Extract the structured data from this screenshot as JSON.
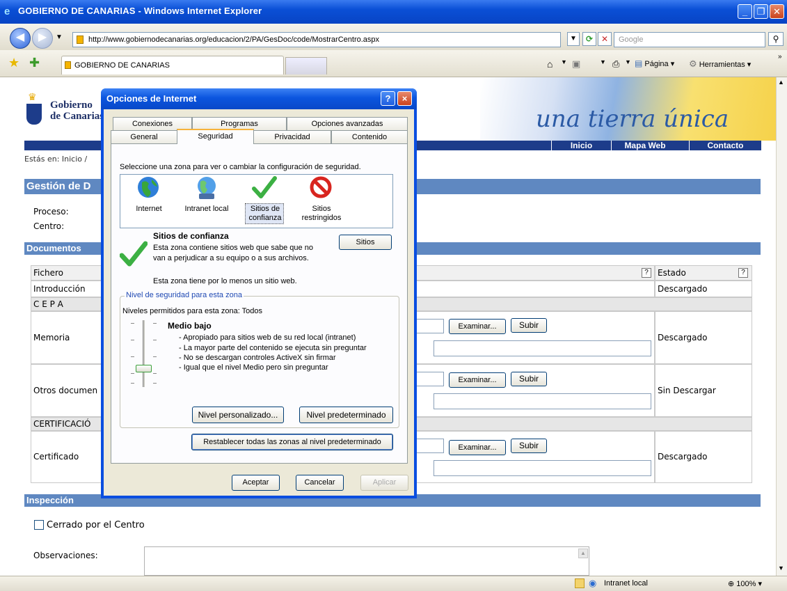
{
  "window": {
    "title": "GOBIERNO DE CANARIAS - Windows Internet Explorer"
  },
  "toolbar": {
    "url": "http://www.gobiernodecanarias.org/educacion/2/PA/GesDoc/code/MostrarCentro.aspx",
    "search_placeholder": "Google",
    "tab_title": "GOBIERNO DE CANARIAS",
    "page_menu": "Página",
    "tools_menu": "Herramientas"
  },
  "site": {
    "logo_line1": "Gobierno",
    "logo_line2": "de Canarias",
    "slogan": "una tierra única",
    "nav": [
      "Inicio",
      "Mapa Web",
      "Contacto"
    ],
    "breadcrumb": "Estás en: Inicio /",
    "section_title": "Gestión de D",
    "proceso_label": "Proceso:",
    "centro_label": "Centro:",
    "documentos_header": "Documentos",
    "table_headers": {
      "file": "Fichero",
      "status": "Estado",
      "help": "?"
    },
    "rows": [
      {
        "name": "Introducción",
        "status": "Descargado"
      },
      {
        "name": "C E P A",
        "status": ""
      },
      {
        "name": "Memoria",
        "status": "Descargado"
      },
      {
        "name": "Otros documen",
        "status": "Sin Descargar"
      },
      {
        "name": "CERTIFICACIÓ",
        "status": ""
      },
      {
        "name": "Certificado",
        "status": "Descargado"
      }
    ],
    "examinar_label": "Examinar...",
    "subir_label": "Subir",
    "inspeccion_header": "Inspección",
    "cerrado_label": "Cerrado por el Centro",
    "observaciones_label": "Observaciones:"
  },
  "status_bar": {
    "zone": "Intranet local",
    "zoom": "100%"
  },
  "dialog": {
    "title": "Opciones de Internet",
    "help_btn": "?",
    "close_btn": "×",
    "tabs_row1": [
      "Conexiones",
      "Programas",
      "Opciones avanzadas"
    ],
    "tabs_row2": [
      "General",
      "Seguridad",
      "Privacidad",
      "Contenido"
    ],
    "instruction": "Seleccione una zona para ver o cambiar la configuración de seguridad.",
    "zones": [
      {
        "line1": "Internet",
        "line2": ""
      },
      {
        "line1": "Intranet local",
        "line2": ""
      },
      {
        "line1": "Sitios de",
        "line2": "confianza"
      },
      {
        "line1": "Sitios",
        "line2": "restringidos"
      }
    ],
    "zone_title": "Sitios de confianza",
    "zone_desc1": "Esta zona contiene sitios web que sabe que no",
    "zone_desc2": "van a perjudicar a su equipo o a sus archivos.",
    "sitios_btn": "Sitios",
    "zone_has_site": "Esta zona tiene por lo menos un sitio web.",
    "group_title": "Nivel de seguridad para esta zona",
    "allowed_levels": "Niveles permitidos para esta zona: Todos",
    "level_name": "Medio bajo",
    "level_points": [
      "- Apropiado para sitios web de su red local (intranet)",
      "- La mayor parte del contenido se ejecuta sin preguntar",
      "- No se descargan controles ActiveX sin firmar",
      "- Igual que el nivel Medio pero sin preguntar"
    ],
    "custom_level_btn": "Nivel personalizado...",
    "default_level_btn": "Nivel predeterminado",
    "reset_all_btn": "Restablecer todas las zonas al nivel predeterminado",
    "ok_btn": "Aceptar",
    "cancel_btn": "Cancelar",
    "apply_btn": "Aplicar"
  }
}
